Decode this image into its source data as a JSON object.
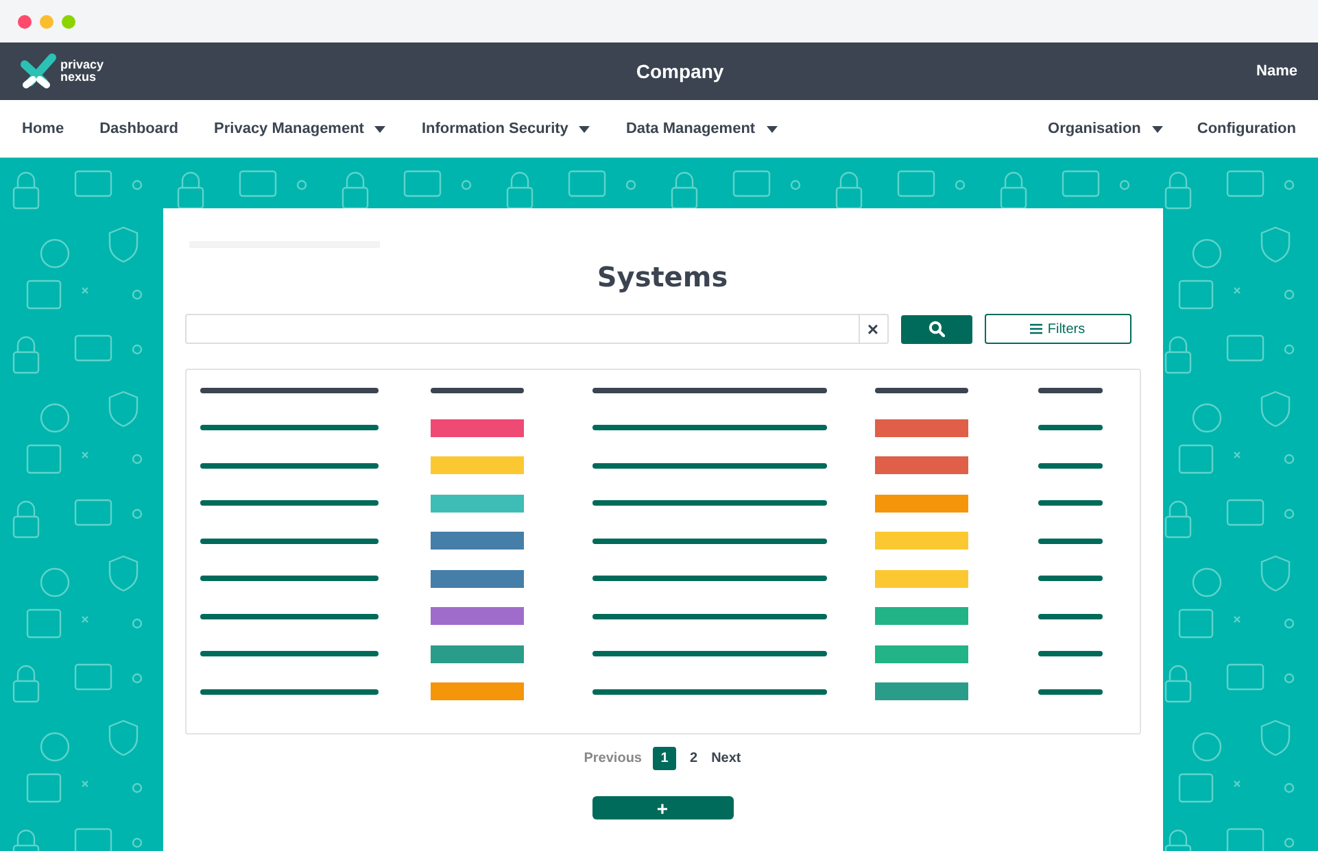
{
  "app": {
    "logo_text": [
      "privacy",
      "nexus"
    ],
    "company": "Company",
    "user": "Name"
  },
  "nav": {
    "left": [
      {
        "label": "Home",
        "dropdown": false
      },
      {
        "label": "Dashboard",
        "dropdown": false
      },
      {
        "label": "Privacy Management",
        "dropdown": true
      },
      {
        "label": "Information Security",
        "dropdown": true
      },
      {
        "label": "Data Management",
        "dropdown": true
      }
    ],
    "right": [
      {
        "label": "Organisation",
        "dropdown": true
      },
      {
        "label": "Configuration",
        "dropdown": false
      }
    ]
  },
  "page": {
    "title": "Systems",
    "filters_button": "Filters",
    "clear_button": "×",
    "add_button": "+"
  },
  "table": {
    "rows": [
      {
        "column_2": {
          "color": "#ef4a73"
        },
        "column_4": {
          "color": "#df5f48"
        }
      },
      {
        "column_2": {
          "color": "#fcc832"
        },
        "column_4": {
          "color": "#df5f48"
        }
      },
      {
        "column_2": {
          "color": "#3dbdb5"
        },
        "column_4": {
          "color": "#f5960a"
        }
      },
      {
        "column_2": {
          "color": "#457ea8"
        },
        "column_4": {
          "color": "#fcc832"
        }
      },
      {
        "column_2": {
          "color": "#457ea8"
        },
        "column_4": {
          "color": "#fcc832"
        }
      },
      {
        "column_2": {
          "color": "#a06ccc"
        },
        "column_4": {
          "color": "#22b386"
        }
      },
      {
        "column_2": {
          "color": "#2a9d8a"
        },
        "column_4": {
          "color": "#22b386"
        }
      },
      {
        "column_2": {
          "color": "#f5950a"
        },
        "column_4": {
          "color": "#2a9d8a"
        }
      }
    ]
  },
  "pagination": {
    "previous": {
      "label": "Previous",
      "disabled": true
    },
    "pages": [
      {
        "label": "1",
        "selected": true
      },
      {
        "label": "2",
        "selected": false
      }
    ],
    "next": {
      "label": "Next",
      "disabled": false
    }
  }
}
